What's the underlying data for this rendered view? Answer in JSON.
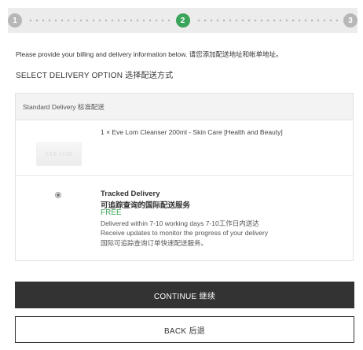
{
  "stepper": {
    "steps": [
      {
        "number": "1",
        "state": "inactive"
      },
      {
        "number": "2",
        "state": "active"
      },
      {
        "number": "3",
        "state": "inactive"
      }
    ],
    "colors": {
      "active": "#3aa55a",
      "inactive": "#b7b7b7"
    }
  },
  "intro_text": "Please provide your billing and delivery information below. 请您添加配送地址和帐单地址。",
  "section_title": "SELECT DELIVERY OPTION 选择配送方式",
  "delivery_box": {
    "header": "Standard Delivery 标准配送",
    "product": {
      "line": "1 × Eve Lom Cleanser 200ml - Skin Care [Health and Beauty]",
      "thumbnail_text": "EVE LOM"
    },
    "option": {
      "selected": true,
      "title": "Tracked Delivery",
      "title_cn": "可追踪查询的国际配送服务",
      "price": "FREE",
      "delivery_time": "Delivered within 7-10 working days 7-10工作日内送达",
      "updates": "Receive updates to monitor the progress of your delivery",
      "updates_cn": "国际可追踪查询订单快速配送服务。"
    }
  },
  "buttons": {
    "continue_label": "CONTINUE 继续",
    "back_label": "BACK 后退"
  },
  "colors": {
    "accent": "#3aa55a",
    "primary_button": "#333333"
  }
}
